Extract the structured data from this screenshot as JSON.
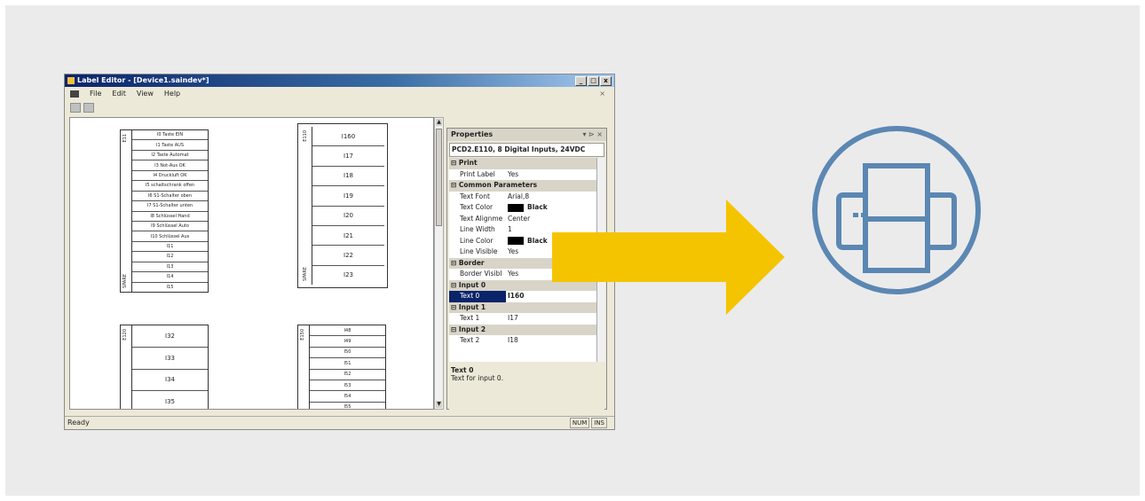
{
  "window": {
    "title": "Label Editor - [Device1.saindev*]",
    "btn_min": "_",
    "btn_max": "□",
    "btn_close": "x",
    "menu_close": "×"
  },
  "menu": {
    "file": "File",
    "edit": "Edit",
    "view": "View",
    "help": "Help"
  },
  "label1": {
    "top_side": "E11",
    "bottom_side": "SPARE",
    "rows": [
      "I0 Taste EIN",
      "I1 Taste AUS",
      "I2 Taste Automat",
      "I3 Not-Aus OK",
      "I4 Druckluft OK",
      "I5 schaltschrank offen",
      "I6 S1-Schalter oben",
      "I7 S1-Schalter unten",
      "I8 Schlüssel Hand",
      "I9 Schlüssel Auto",
      "I10 Schlüssel Aus",
      "I11",
      "I12",
      "I13",
      "I14",
      "I15"
    ]
  },
  "label2": {
    "top_side": "E110",
    "bottom_side": "SPARE",
    "rows": [
      "I160",
      "I17",
      "I18",
      "I19",
      "I20",
      "I21",
      "I22",
      "I23"
    ]
  },
  "label3": {
    "side": "E120",
    "rows": [
      "I32",
      "I33",
      "I34",
      "I35"
    ]
  },
  "label4": {
    "side": "E150",
    "rows": [
      "I48",
      "I49",
      "I50",
      "I51",
      "I52",
      "I53",
      "I54",
      "I55"
    ]
  },
  "properties": {
    "header": "Properties",
    "header_ctrls": "▾ ⊳ ×",
    "object": "PCD2.E110, 8 Digital Inputs, 24VDC",
    "rows": [
      {
        "type": "cat",
        "name": "⊟ Print"
      },
      {
        "name": "Print Label",
        "value": "Yes"
      },
      {
        "type": "cat",
        "name": "⊟ Common Parameters"
      },
      {
        "name": "Text Font",
        "value": "Arial,8"
      },
      {
        "name": "Text Color",
        "value": "Black",
        "swatch": "#000000"
      },
      {
        "name": "Text Alignme",
        "value": "Center"
      },
      {
        "name": "Line Width",
        "value": "1"
      },
      {
        "name": "Line Color",
        "value": "Black",
        "swatch": "#000000"
      },
      {
        "name": "Line Visible",
        "value": "Yes"
      },
      {
        "type": "cat",
        "name": "⊟ Border"
      },
      {
        "name": "Border Visibl",
        "value": "Yes"
      },
      {
        "type": "cat",
        "name": "⊟ Input 0"
      },
      {
        "name": "Text 0",
        "value": "I160",
        "selected": true
      },
      {
        "type": "cat",
        "name": "⊟ Input 1"
      },
      {
        "name": "Text 1",
        "value": "I17"
      },
      {
        "type": "cat",
        "name": "⊟ Input 2"
      },
      {
        "name": "Text 2",
        "value": "I18"
      }
    ],
    "desc_title": "Text 0",
    "desc_text": "Text for input 0."
  },
  "status": {
    "text": "Ready",
    "num": "NUM",
    "ins": "INS"
  },
  "colors": {
    "arrow": "#f5c400",
    "printer": "#5b87b3",
    "background": "#ebebeb"
  }
}
